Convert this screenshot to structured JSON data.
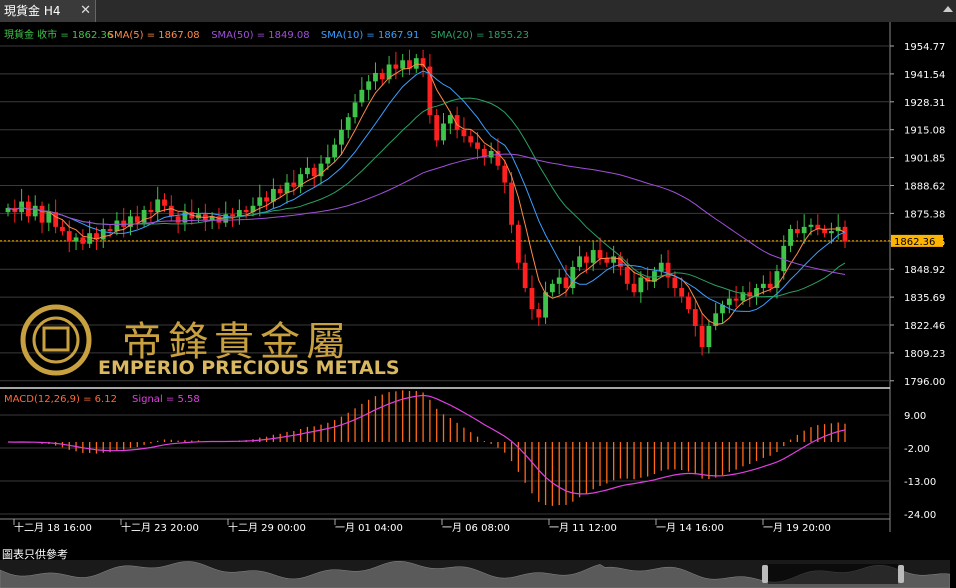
{
  "tab": {
    "title": "現貨金 H4",
    "close": "✕"
  },
  "legend": [
    {
      "text": "現貨金 收市 = 1862.36",
      "color": "#3ec44a"
    },
    {
      "text": "SMA(5) = 1867.08",
      "color": "#ff8a4a"
    },
    {
      "text": "SMA(50) = 1849.08",
      "color": "#a050d8"
    },
    {
      "text": "SMA(10) = 1867.91",
      "color": "#3a9fff"
    },
    {
      "text": "SMA(20) = 1855.23",
      "color": "#2aa064"
    }
  ],
  "macd_legend": [
    {
      "text": "MACD(12,26,9) = 6.12",
      "color": "#ff6a3a"
    },
    {
      "text": "Signal = 5.58",
      "color": "#e040e0"
    }
  ],
  "watermark": {
    "chinese": "帝鋒貴金屬",
    "english": "EMPERIO PRECIOUS METALS"
  },
  "price_axis": [
    "1954.77",
    "1941.54",
    "1928.31",
    "1915.08",
    "1901.85",
    "1888.62",
    "1875.38",
    "1862.15",
    "1848.92",
    "1835.69",
    "1822.46",
    "1809.23",
    "1796.00"
  ],
  "current_price": "1862.36",
  "macd_axis": [
    "9.00",
    "-2.00",
    "-13.00",
    "-24.00"
  ],
  "time_axis": [
    "十二月 18 16:00",
    "十二月 23 20:00",
    "十二月 29 00:00",
    "一月 01 04:00",
    "一月 06 08:00",
    "一月 11 12:00",
    "一月 14 16:00",
    "一月 19 20:00"
  ],
  "disclaimer": "圖表只供參考",
  "colors": {
    "up": "#3ec44a",
    "down": "#ff2020",
    "grid": "#3a3a3a",
    "axis_text": "#ffffff",
    "price_line": "#ffb400",
    "macd_hist": "#ff6a1a",
    "signal": "#e040e0"
  },
  "chart_data": {
    "type": "candlestick",
    "closes": [
      1878,
      1876,
      1881,
      1874,
      1879,
      1871,
      1876,
      1869,
      1867,
      1862,
      1864,
      1861,
      1866,
      1863,
      1868,
      1867,
      1872,
      1869,
      1874,
      1871,
      1877,
      1876,
      1882,
      1879,
      1874,
      1871,
      1876,
      1873,
      1875,
      1872,
      1874,
      1871,
      1875,
      1874,
      1877,
      1876,
      1879,
      1883,
      1881,
      1887,
      1885,
      1890,
      1888,
      1894,
      1897,
      1893,
      1899,
      1902,
      1908,
      1915,
      1921,
      1928,
      1934,
      1938,
      1942,
      1939,
      1946,
      1944,
      1948,
      1944,
      1949,
      1945,
      1922,
      1910,
      1918,
      1922,
      1915,
      1912,
      1909,
      1906,
      1902,
      1905,
      1898,
      1890,
      1870,
      1852,
      1840,
      1830,
      1826,
      1838,
      1842,
      1845,
      1840,
      1850,
      1855,
      1852,
      1858,
      1854,
      1852,
      1855,
      1850,
      1842,
      1838,
      1845,
      1843,
      1848,
      1852,
      1845,
      1840,
      1836,
      1830,
      1822,
      1812,
      1822,
      1828,
      1832,
      1835,
      1834,
      1838,
      1836,
      1840,
      1842,
      1840,
      1848,
      1860,
      1868,
      1866,
      1869,
      1870,
      1868,
      1866,
      1867,
      1869,
      1862
    ],
    "price_range": [
      1796,
      1960
    ],
    "macd_range": [
      -27,
      12
    ]
  }
}
